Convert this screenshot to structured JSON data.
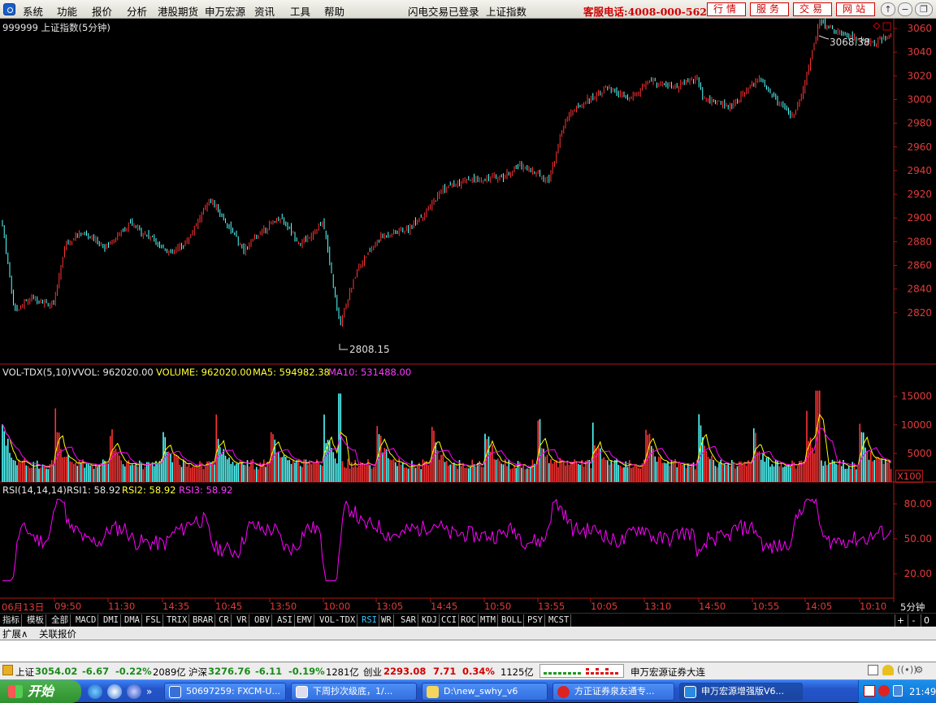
{
  "menu": [
    "系统",
    "功能",
    "报价",
    "分析",
    "港股期货",
    "申万宏源",
    "资讯",
    "工具",
    "帮助"
  ],
  "status": {
    "flash_login": "闪电交易已登录",
    "index_name": "上证指数"
  },
  "hotline": "客服电话:4008-000-562",
  "top_buttons": [
    "行情",
    "服务",
    "交易",
    "网站"
  ],
  "window_controls": [
    "↑",
    "−",
    "❐",
    "✕"
  ],
  "price_panel": {
    "title": "999999 上证指数(5分钟)",
    "high_label": "3068.38",
    "low_label": "2808.15",
    "y_ticks": [
      "3060",
      "3040",
      "3020",
      "3000",
      "2980",
      "2960",
      "2940",
      "2920",
      "2900",
      "2880",
      "2860",
      "2840",
      "2820"
    ]
  },
  "vol_panel": {
    "name": "VOL-TDX(5,10)",
    "vvol": "VVOL: 962020.00",
    "volume": "VOLUME: 962020.00",
    "ma5": "MA5: 594982.38",
    "ma10": "MA10: 531488.00",
    "y_ticks": [
      "15000",
      "10000",
      "5000"
    ],
    "unit": "X100"
  },
  "rsi_panel": {
    "name": "RSI(14,14,14)",
    "rsi1": "RSI1: 58.92",
    "rsi2": "RSI2: 58.92",
    "rsi3": "RSI3: 58.92",
    "y_ticks": [
      "80.00",
      "50.00",
      "20.00"
    ]
  },
  "x_ticks": [
    "06月13日",
    "09:50",
    "11:30",
    "14:35",
    "10:45",
    "13:50",
    "10:00",
    "13:05",
    "14:45",
    "10:50",
    "13:55",
    "10:05",
    "13:10",
    "14:50",
    "10:55",
    "14:05",
    "10:10"
  ],
  "period": "5分钟",
  "indicator_tabs": [
    "指标",
    "模板",
    "全部",
    "MACD",
    "DMI",
    "DMA",
    "FSL",
    "TRIX",
    "BRAR",
    "CR",
    "VR",
    "OBV",
    "ASI",
    "EMV",
    "VOL-TDX",
    "RSI",
    "WR",
    "SAR",
    "KDJ",
    "CCI",
    "ROC",
    "MTM",
    "BOLL",
    "PSY",
    "MCST"
  ],
  "active_indicator": "RSI",
  "side_controls": [
    "+",
    "-",
    "0"
  ],
  "ext_tabs": [
    "扩展∧",
    "关联报价"
  ],
  "quotes": {
    "sh_label": "上证",
    "sh_value": "3054.02",
    "sh_change": "-6.67",
    "sh_pct": "-0.22%",
    "sh_amt": "2089亿",
    "hs_label": "沪深",
    "hs_value": "3276.76",
    "hs_change": "-6.11",
    "hs_pct": "-0.19%",
    "hs_amt": "1281亿",
    "cy_label": "创业",
    "cy_value": "2293.08",
    "cy_change": "7.71",
    "cy_pct": "0.34%",
    "cy_amt": "1125亿",
    "broker": "申万宏源证券大连"
  },
  "taskbar": {
    "start": "开始",
    "tasks": [
      "50697259: FXCM-U...",
      "下周抄次级底，1/...",
      "D:\\new_swhy_v6",
      "方正证券泉友通专...",
      "申万宏源增强版V6..."
    ],
    "clock": "21:49"
  },
  "colors": {
    "up": "#ff3232",
    "down": "#54ffff",
    "axis": "#b01818",
    "ma5": "#ffff00",
    "ma10": "#ff00ff",
    "rsi": "#ff00ff",
    "text_red": "#e23b3b"
  }
}
